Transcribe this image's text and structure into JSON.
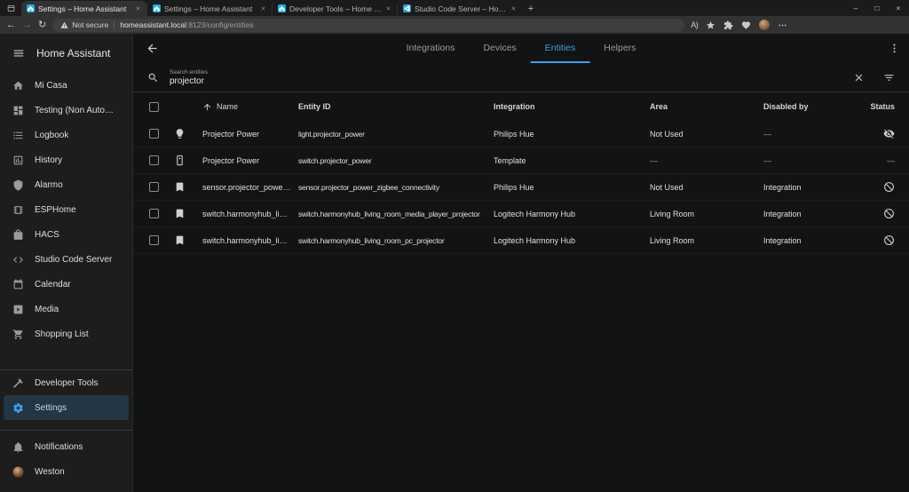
{
  "colors": {
    "accent": "#36a3e4"
  },
  "browser": {
    "tabs": [
      {
        "title": "Settings – Home Assistant",
        "icon": "ha-favicon",
        "active": true
      },
      {
        "title": "Settings – Home Assistant",
        "icon": "ha-favicon",
        "active": false
      },
      {
        "title": "Developer Tools – Home Assistan",
        "icon": "ha-favicon",
        "active": false
      },
      {
        "title": "Studio Code Server – Home Assi",
        "icon": "vscode-favicon",
        "active": false
      }
    ],
    "address": {
      "security_label": "Not secure",
      "host": "homeassistant.local",
      "path": ":8123/config/entities"
    }
  },
  "sidebar": {
    "title": "Home Assistant",
    "items": [
      {
        "label": "Mi Casa",
        "icon": "home"
      },
      {
        "label": "Testing (Non Automatic)",
        "icon": "dashboard"
      },
      {
        "label": "Logbook",
        "icon": "list"
      },
      {
        "label": "History",
        "icon": "chart"
      },
      {
        "label": "Alarmo",
        "icon": "shield"
      },
      {
        "label": "ESPHome",
        "icon": "chip"
      },
      {
        "label": "HACS",
        "icon": "bag"
      },
      {
        "label": "Studio Code Server",
        "icon": "code"
      },
      {
        "label": "Calendar",
        "icon": "calendar"
      },
      {
        "label": "Media",
        "icon": "play-box"
      },
      {
        "label": "Shopping List",
        "icon": "cart"
      }
    ],
    "tools": [
      {
        "label": "Developer Tools",
        "icon": "hammer",
        "active": false
      },
      {
        "label": "Settings",
        "icon": "cog",
        "active": true
      }
    ],
    "footer": [
      {
        "label": "Notifications",
        "icon": "bell"
      },
      {
        "label": "Weston",
        "icon": "avatar"
      }
    ]
  },
  "header": {
    "tabs": [
      {
        "label": "Integrations",
        "active": false
      },
      {
        "label": "Devices",
        "active": false
      },
      {
        "label": "Entities",
        "active": true
      },
      {
        "label": "Helpers",
        "active": false
      }
    ]
  },
  "search": {
    "label": "Search entities",
    "value": "projector"
  },
  "table": {
    "columns": [
      "Name",
      "Entity ID",
      "Integration",
      "Area",
      "Disabled by",
      "Status"
    ],
    "rows": [
      {
        "icon": "lightbulb",
        "name": "Projector Power",
        "entity_id": "light.projector_power",
        "integration": "Philips Hue",
        "area": "Not Used",
        "disabled_by": "—",
        "status": "hidden"
      },
      {
        "icon": "switch",
        "name": "Projector Power",
        "entity_id": "switch.projector_power",
        "integration": "Template",
        "area": "—",
        "disabled_by": "—",
        "status": "—"
      },
      {
        "icon": "bookmark",
        "name": "sensor.projector_power_zigbee_connectivity",
        "entity_id": "sensor.projector_power_zigbee_connectivity",
        "integration": "Philips Hue",
        "area": "Not Used",
        "disabled_by": "Integration",
        "status": "disabled"
      },
      {
        "icon": "bookmark",
        "name": "switch.harmonyhub_living_room_media_player_projector",
        "entity_id": "switch.harmonyhub_living_room_media_player_projector",
        "integration": "Logitech Harmony Hub",
        "area": "Living Room",
        "disabled_by": "Integration",
        "status": "disabled"
      },
      {
        "icon": "bookmark",
        "name": "switch.harmonyhub_living_room_pc_projector",
        "entity_id": "switch.harmonyhub_living_room_pc_projector",
        "integration": "Logitech Harmony Hub",
        "area": "Living Room",
        "disabled_by": "Integration",
        "status": "disabled"
      }
    ]
  }
}
